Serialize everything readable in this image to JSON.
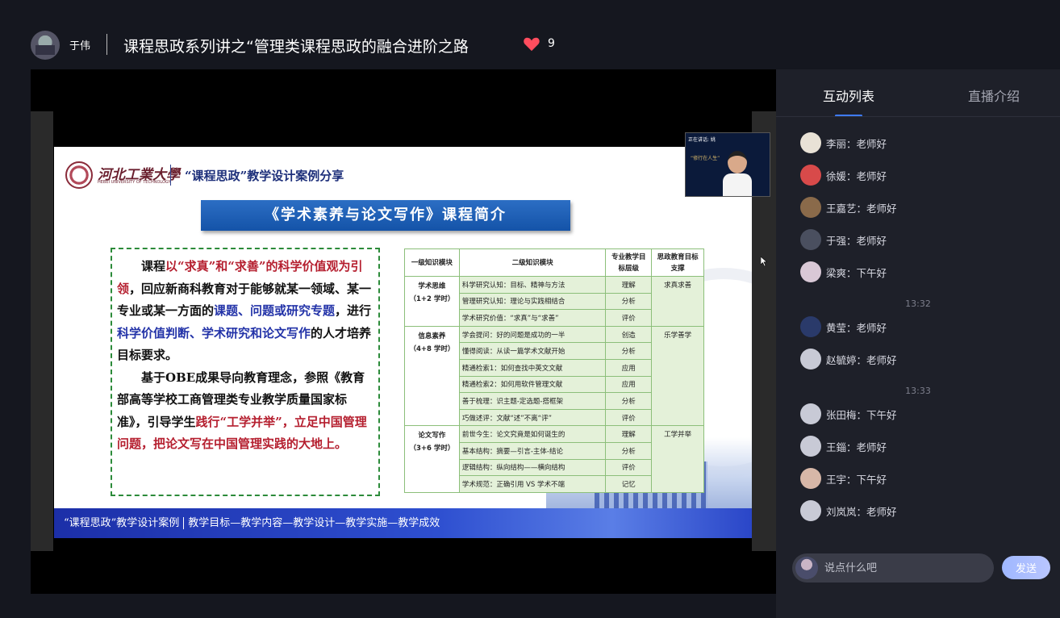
{
  "header": {
    "host_name": "于伟",
    "live_title": "课程思政系列讲之“管理类课程思政的融合进阶之路",
    "like_count": "9",
    "like_color": "#ff4d5e"
  },
  "slide": {
    "school_name": "河北工業大學",
    "school_en": "HEBEI UNIVERSITY OF TECHNOLOGY",
    "subtitle": "“课程思政”教学设计案例分享",
    "banner": "《学术素养与论文写作》课程简介",
    "intro": {
      "p1": [
        {
          "t": "课程",
          "c": ""
        },
        {
          "t": "以“求真”和“求善”的科学价值观为引领",
          "c": "red"
        },
        {
          "t": "，回应新商科教育对于能够就某一领域、某一专业或某一方面的",
          "c": ""
        },
        {
          "t": "课题、问题或研究专题",
          "c": "blue"
        },
        {
          "t": "，进行",
          "c": ""
        },
        {
          "t": "科学价值判断、学术研究和论文写作",
          "c": "blue"
        },
        {
          "t": "的人才培养目标要求。",
          "c": ""
        }
      ],
      "p2": [
        {
          "t": "基于OBE成果导向教育理念，参照《教育部高等学校工商管理类专业教学质量国家标准》，引导学生",
          "c": ""
        },
        {
          "t": "践行“工学并举”，立足中国管理问题，把论文写在中国管理实践的大地上。",
          "c": "red"
        }
      ]
    },
    "table": {
      "headers": [
        "一级知识模块",
        "二级知识模块",
        "专业教学目标层级",
        "思政教育目标支撑"
      ],
      "groups": [
        {
          "category": "学术思维\n（1+2 学时）",
          "support": "求真求善",
          "rows": [
            {
              "topic": "科学研究认知：目标、精神与方法",
              "level": "理解"
            },
            {
              "topic": "管理研究认知：理论与实践相结合",
              "level": "分析"
            },
            {
              "topic": "学术研究价值：“求真”与“求善”",
              "level": "评价"
            }
          ]
        },
        {
          "category": "信息素养\n（4+8 学时）",
          "support": "乐学善学",
          "rows": [
            {
              "topic": "学会提问：好的问题是成功的一半",
              "level": "创造"
            },
            {
              "topic": "懂得阅读：从读一篇学术文献开始",
              "level": "分析"
            },
            {
              "topic": "精通检索1：如何查找中英文文献",
              "level": "应用"
            },
            {
              "topic": "精通检索2：如何用软件管理文献",
              "level": "应用"
            },
            {
              "topic": "善于梳理：识主题-定选题-搭框架",
              "level": "分析"
            },
            {
              "topic": "巧做述评：文献“述”不离“评”",
              "level": "评价"
            }
          ]
        },
        {
          "category": "论文写作\n（3+6 学时）",
          "support": "工学并举",
          "rows": [
            {
              "topic": "前世今生：论文究竟是如何诞生的",
              "level": "理解"
            },
            {
              "topic": "基本结构：摘要—引言-主体-结论",
              "level": "分析"
            },
            {
              "topic": "逻辑结构：纵向结构——横向结构",
              "level": "评价"
            },
            {
              "topic": "学术规范：正确引用 VS 学术不端",
              "level": "记忆"
            }
          ]
        }
      ]
    },
    "footer": {
      "left": "“课程思政”教学设计案例",
      "right": "教学目标—教学内容—教学设计—教学实施—教学成效"
    },
    "pip": {
      "label": "正在讲话: 姚",
      "caption": "“修行在人生”"
    }
  },
  "sidebar": {
    "tab_interact": "互动列表",
    "tab_intro": "直播介绍",
    "accent_color": "#3e7bff",
    "messages": [
      {
        "type": "msg",
        "text": "李丽：老师好",
        "avatar": "#e9e2d6"
      },
      {
        "type": "msg",
        "text": "徐媛：老师好",
        "avatar": "#d84a4a"
      },
      {
        "type": "msg",
        "text": "王嘉艺：老师好",
        "avatar": "#8a6a4a"
      },
      {
        "type": "msg",
        "text": "于强：老师好",
        "avatar": "#4a4f5f"
      },
      {
        "type": "msg",
        "text": "梁爽：下午好",
        "avatar": "#d9c8d6"
      },
      {
        "type": "time",
        "text": "13:32"
      },
      {
        "type": "msg",
        "text": "黄莹：老师好",
        "avatar": "#2a3a6a"
      },
      {
        "type": "msg",
        "text": "赵毓婷：老师好",
        "avatar": "#c8cad6"
      },
      {
        "type": "time",
        "text": "13:33"
      },
      {
        "type": "msg",
        "text": "张田梅：下午好",
        "avatar": "#c8cad6"
      },
      {
        "type": "msg",
        "text": "王錙：老师好",
        "avatar": "#c8cad6"
      },
      {
        "type": "msg",
        "text": "王宇：下午好",
        "avatar": "#d7b7a8"
      },
      {
        "type": "msg",
        "text": "刘岚岚：老师好",
        "avatar": "#c8cad6"
      }
    ],
    "input_placeholder": "说点什么吧",
    "send_label": "发送"
  }
}
